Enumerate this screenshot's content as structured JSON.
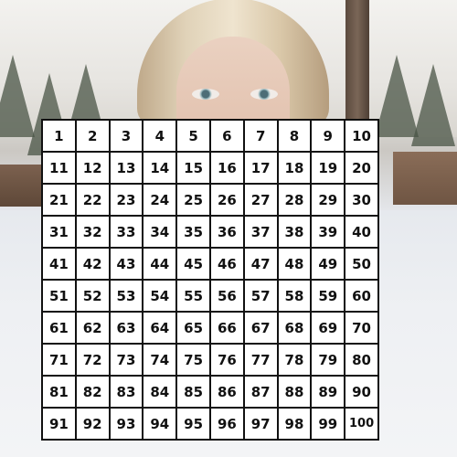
{
  "background": {
    "subject": "photo of a blonde woman in a snowy forest behind a number grid"
  },
  "grid": {
    "rows": [
      [
        "1",
        "2",
        "3",
        "4",
        "5",
        "6",
        "7",
        "8",
        "9",
        "10"
      ],
      [
        "11",
        "12",
        "13",
        "14",
        "15",
        "16",
        "17",
        "18",
        "19",
        "20"
      ],
      [
        "21",
        "22",
        "23",
        "24",
        "25",
        "26",
        "27",
        "28",
        "29",
        "30"
      ],
      [
        "31",
        "32",
        "33",
        "34",
        "35",
        "36",
        "37",
        "38",
        "39",
        "40"
      ],
      [
        "41",
        "42",
        "43",
        "44",
        "45",
        "46",
        "47",
        "48",
        "49",
        "50"
      ],
      [
        "51",
        "52",
        "53",
        "54",
        "55",
        "56",
        "57",
        "58",
        "59",
        "60"
      ],
      [
        "61",
        "62",
        "63",
        "64",
        "65",
        "66",
        "67",
        "68",
        "69",
        "70"
      ],
      [
        "71",
        "72",
        "73",
        "74",
        "75",
        "76",
        "77",
        "78",
        "79",
        "80"
      ],
      [
        "81",
        "82",
        "83",
        "84",
        "85",
        "86",
        "87",
        "88",
        "89",
        "90"
      ],
      [
        "91",
        "92",
        "93",
        "94",
        "95",
        "96",
        "97",
        "98",
        "99",
        "100"
      ]
    ],
    "colors": {
      "cell_background": "#ffffff",
      "border": "#111111",
      "text": "#111111"
    }
  }
}
